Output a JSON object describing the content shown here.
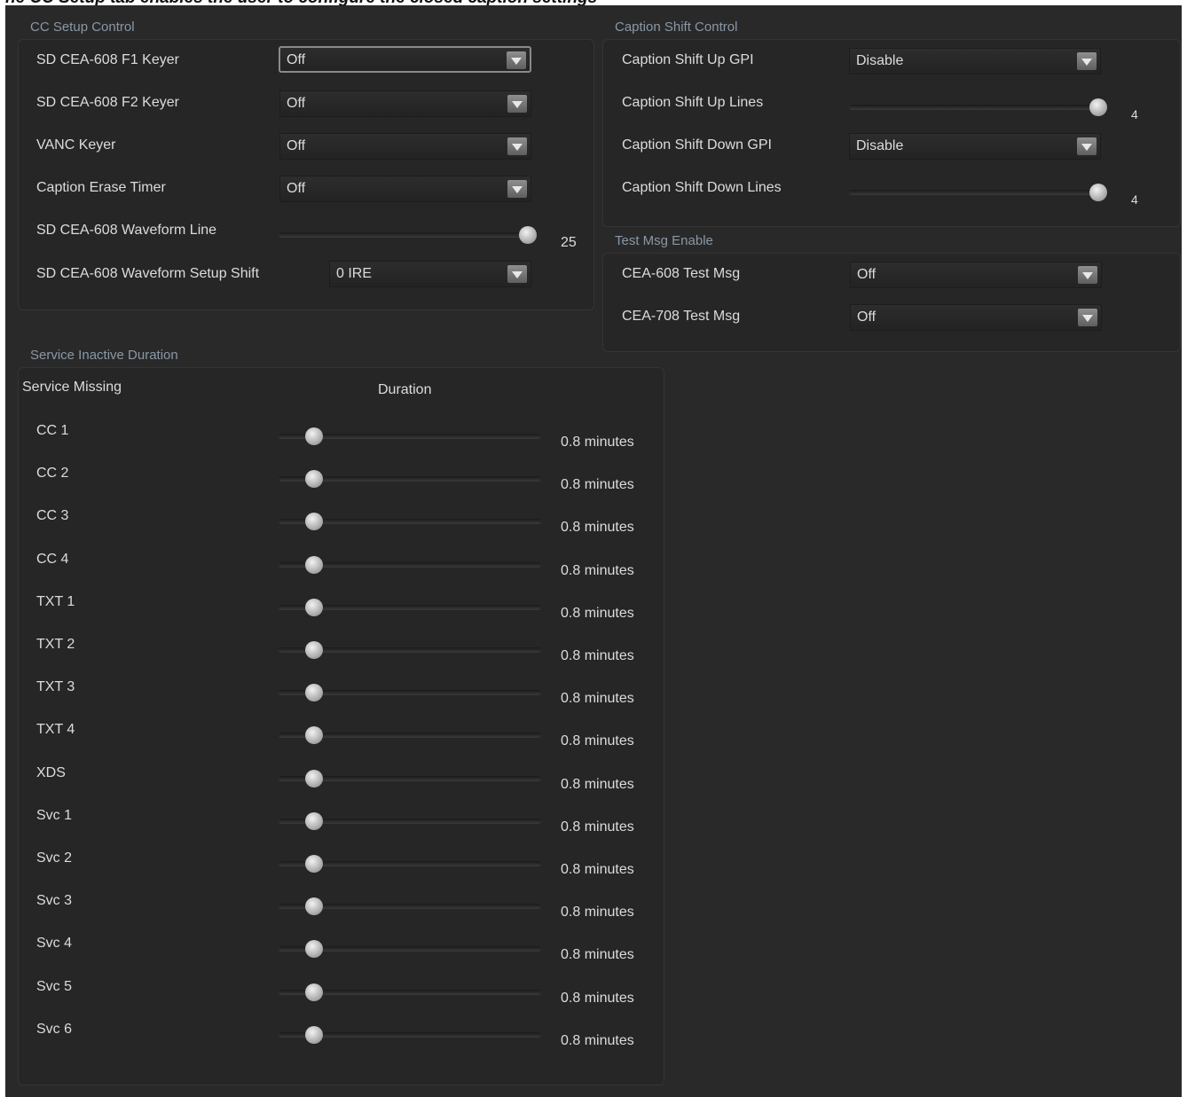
{
  "top_caption": "he CC Setup tab enables the user to configure the closed caption settings",
  "cc_setup": {
    "title": "CC Setup Control",
    "f1_keyer": {
      "label": "SD CEA-608 F1 Keyer",
      "value": "Off"
    },
    "f2_keyer": {
      "label": "SD CEA-608 F2 Keyer",
      "value": "Off"
    },
    "vanc_keyer": {
      "label": "VANC Keyer",
      "value": "Off"
    },
    "erase_timer": {
      "label": "Caption Erase Timer",
      "value": "Off"
    },
    "waveform_line": {
      "label": "SD CEA-608 Waveform Line",
      "value": "25",
      "fraction": 1.0
    },
    "setup_shift": {
      "label": "SD CEA-608 Waveform Setup Shift",
      "value": "0 IRE"
    }
  },
  "caption_shift": {
    "title": "Caption Shift Control",
    "up_gpi": {
      "label": "Caption Shift Up GPI",
      "value": "Disable"
    },
    "up_lines": {
      "label": "Caption Shift Up Lines",
      "value": "4",
      "fraction": 1.0
    },
    "down_gpi": {
      "label": "Caption Shift Down GPI",
      "value": "Disable"
    },
    "down_lines": {
      "label": "Caption Shift Down Lines",
      "value": "4",
      "fraction": 1.0
    }
  },
  "test_msg": {
    "title": "Test Msg Enable",
    "cea608": {
      "label": "CEA-608 Test Msg",
      "value": "Off"
    },
    "cea708": {
      "label": "CEA-708 Test Msg",
      "value": "Off"
    }
  },
  "service_inactive": {
    "title": "Service Inactive Duration",
    "col_service": "Service Missing",
    "col_duration": "Duration",
    "rows": [
      {
        "label": "CC 1",
        "value": "0.8 minutes",
        "fraction": 0.11
      },
      {
        "label": "CC 2",
        "value": "0.8 minutes",
        "fraction": 0.11
      },
      {
        "label": "CC 3",
        "value": "0.8 minutes",
        "fraction": 0.11
      },
      {
        "label": "CC 4",
        "value": "0.8 minutes",
        "fraction": 0.11
      },
      {
        "label": "TXT 1",
        "value": "0.8 minutes",
        "fraction": 0.11
      },
      {
        "label": "TXT 2",
        "value": "0.8 minutes",
        "fraction": 0.11
      },
      {
        "label": "TXT 3",
        "value": "0.8 minutes",
        "fraction": 0.11
      },
      {
        "label": "TXT 4",
        "value": "0.8 minutes",
        "fraction": 0.11
      },
      {
        "label": "XDS",
        "value": "0.8 minutes",
        "fraction": 0.11
      },
      {
        "label": "Svc 1",
        "value": "0.8 minutes",
        "fraction": 0.11
      },
      {
        "label": "Svc 2",
        "value": "0.8 minutes",
        "fraction": 0.11
      },
      {
        "label": "Svc 3",
        "value": "0.8 minutes",
        "fraction": 0.11
      },
      {
        "label": "Svc 4",
        "value": "0.8 minutes",
        "fraction": 0.11
      },
      {
        "label": "Svc 5",
        "value": "0.8 minutes",
        "fraction": 0.11
      },
      {
        "label": "Svc 6",
        "value": "0.8 minutes",
        "fraction": 0.11
      }
    ]
  }
}
